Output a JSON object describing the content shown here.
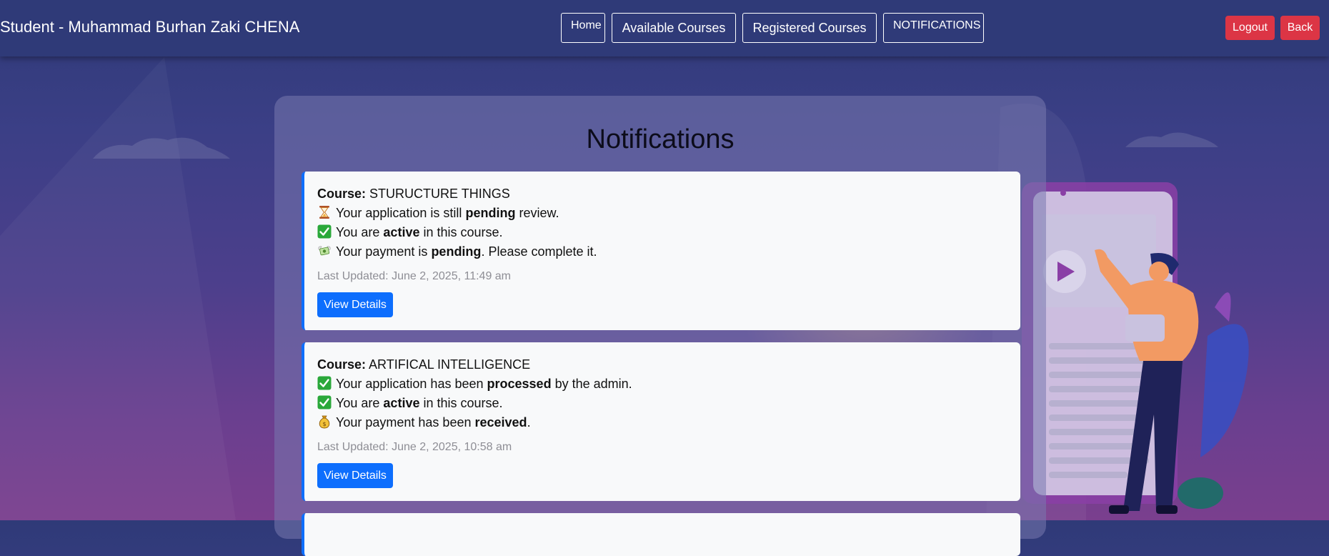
{
  "header": {
    "brand": "Student - Muhammad Burhan Zaki CHENA",
    "nav": {
      "home": "Home",
      "available_courses": "Available Courses",
      "registered_courses": "Registered Courses",
      "notifications": "NOTIFICATIONS"
    },
    "logout": "Logout",
    "back": "Back"
  },
  "main": {
    "title": "Notifications",
    "cards": [
      {
        "course_label": "Course:",
        "course_name": "STURUCTURE THINGS",
        "application": {
          "icon": "hourglass-icon",
          "pre": "Your application is still",
          "bold": "pending",
          "post": "review."
        },
        "enrollment": {
          "icon": "check-icon",
          "pre": "You are",
          "bold": "active",
          "post": "in this course."
        },
        "payment": {
          "icon": "money-wings-icon",
          "pre": "Your payment is",
          "bold": "pending",
          "post": ". Please complete it."
        },
        "last_updated": "Last Updated: June 2, 2025, 11:49 am",
        "button": "View Details"
      },
      {
        "course_label": "Course:",
        "course_name": "ARTIFICAL INTELLIGENCE",
        "application": {
          "icon": "check-icon",
          "pre": "Your application has been",
          "bold": "processed",
          "post": "by the admin."
        },
        "enrollment": {
          "icon": "check-icon",
          "pre": "You are",
          "bold": "active",
          "post": "in this course."
        },
        "payment": {
          "icon": "money-bag-icon",
          "pre": "Your payment has been",
          "bold": "received",
          "post": "."
        },
        "last_updated": "Last Updated: June 2, 2025, 10:58 am",
        "button": "View Details"
      }
    ]
  },
  "colors": {
    "navbar": "#2f3a78",
    "danger": "#dc3545",
    "primary": "#0d6efd",
    "card": "#f8f9fa"
  }
}
